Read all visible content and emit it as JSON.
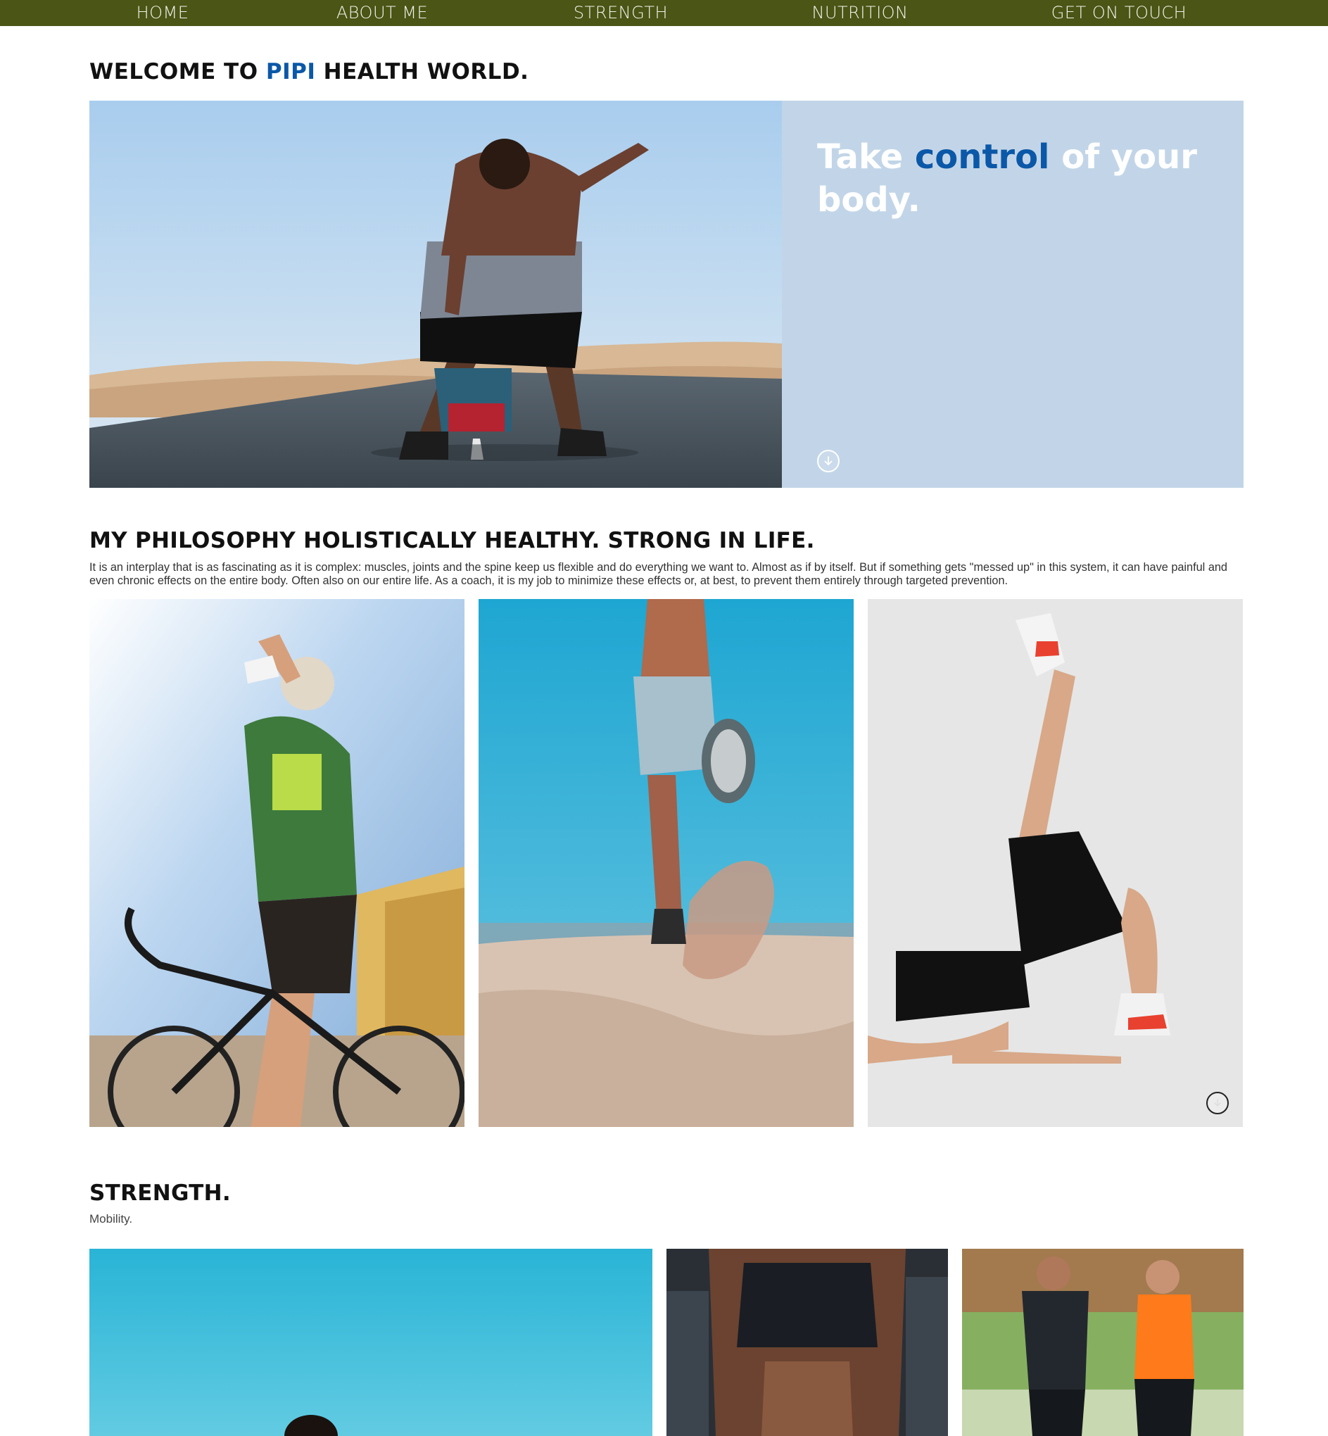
{
  "nav": {
    "items": [
      {
        "label": "HOME"
      },
      {
        "label": "ABOUT ME"
      },
      {
        "label": "STRENGTH"
      },
      {
        "label": "NUTRITION"
      },
      {
        "label": "GET ON TOUCH"
      }
    ]
  },
  "welcome": {
    "before": "WELCOME TO ",
    "accent": "PIPI",
    "after": " HEALTH WORLD."
  },
  "hero": {
    "tagline_before": "Take ",
    "tagline_accent": "control",
    "tagline_after": " of your body.",
    "scroll_icon": "arrow-down-circle-icon"
  },
  "philosophy": {
    "title": "MY PHILOSOPHY HOLISTICALLY HEALTHY. STRONG IN LIFE.",
    "text": "It is an interplay that is as fascinating as it is complex: muscles, joints and the spine keep us flexible and do everything we want to. Almost as if by itself. But if something gets \"messed up\" in this system, it can have painful and even chronic effects on the entire body. Often also on our entire life. As a coach, it is my job to minimize these effects or, at best, to prevent them entirely through targeted prevention."
  },
  "strength": {
    "title": "STRENGTH.",
    "subtitle": "Mobility."
  },
  "colors": {
    "nav_bg": "#4a5516",
    "accent": "#0b58a8",
    "hero_panel": "#c2d5e8"
  }
}
